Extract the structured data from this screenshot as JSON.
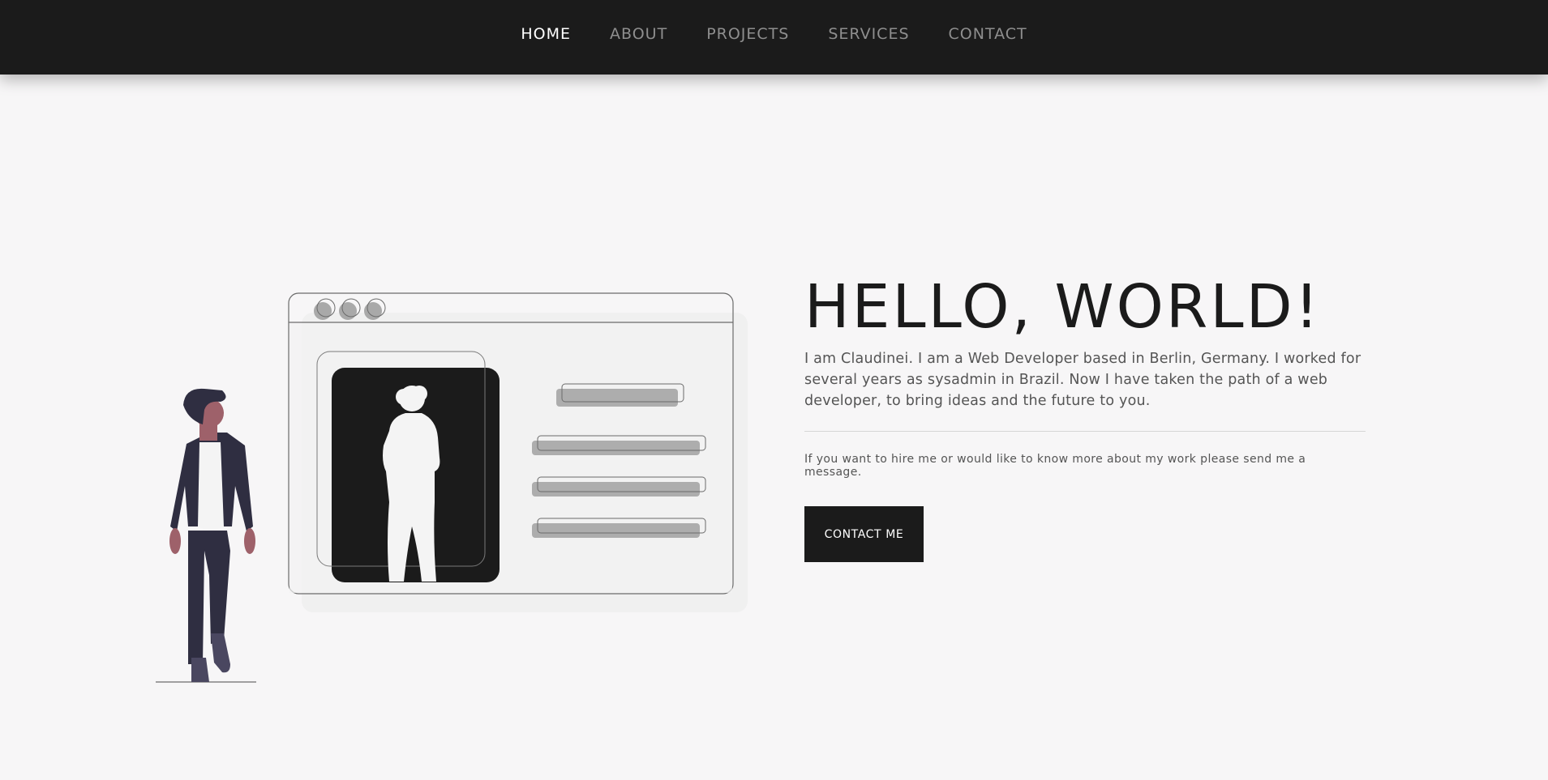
{
  "nav": {
    "items": [
      {
        "label": "HOME",
        "active": true
      },
      {
        "label": "ABOUT",
        "active": false
      },
      {
        "label": "PROJECTS",
        "active": false
      },
      {
        "label": "SERVICES",
        "active": false
      },
      {
        "label": "CONTACT",
        "active": false
      }
    ]
  },
  "hero": {
    "title": "HELLO, WORLD!",
    "description": "I am Claudinei. I am a Web Developer based in Berlin, Germany. I worked for several years as sysadmin in Brazil. Now I have taken the path of a web developer, to bring ideas and the future to you.",
    "note": "If you want to hire me or would like to know more about my work please send me a message.",
    "button_label": "CONTACT ME"
  },
  "illustration": {
    "icons": [
      "person-standing-icon",
      "browser-window-icon",
      "profile-silhouette-icon"
    ]
  },
  "colors": {
    "navbar_bg": "#1b1b1b",
    "page_bg": "#f7f6f7",
    "nav_active": "#ffffff",
    "nav_inactive": "#8e8e8e",
    "skin": "#9e616a",
    "jacket": "#2f2e41",
    "accent_dark": "#1b1b1b"
  }
}
